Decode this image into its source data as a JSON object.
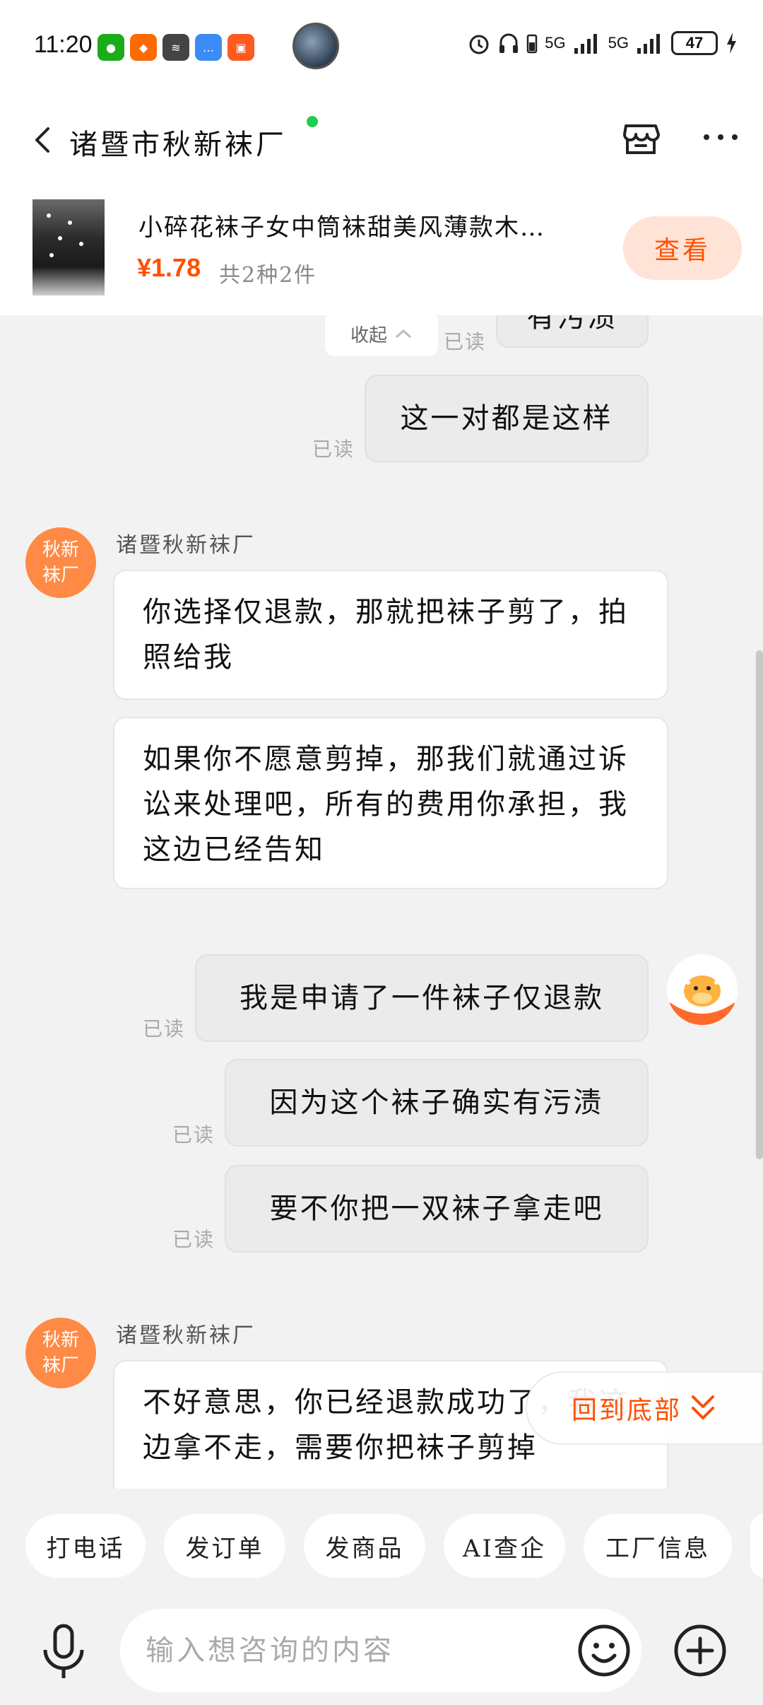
{
  "status": {
    "time": "11:20",
    "app_icons": [
      "wechat-icon",
      "1688-icon",
      "voice-icon",
      "message-icon",
      "app-icon"
    ],
    "network": "5G",
    "battery": "47"
  },
  "header": {
    "shop_name": "诸暨市秋新袜厂",
    "online_color": "#1fce4f"
  },
  "product": {
    "title": "小碎花袜子女中筒袜甜美风薄款木…",
    "price": "¥1.78",
    "qty": "共2种2件",
    "view_label": "查看"
  },
  "chat": {
    "collapse_label": "收起",
    "to_bottom_label": "回到底部",
    "partial_top_text": "有污渍",
    "read_label": "已读",
    "messages": [
      {
        "side": "right",
        "text": "这一对都是这样",
        "read": "已读"
      },
      {
        "side": "left",
        "sender": "诸暨秋新袜厂",
        "avatar": "秋新袜厂",
        "texts": [
          "你选择仅退款，那就把袜子剪了，拍照给我",
          "如果你不愿意剪掉，那我们就通过诉讼来处理吧，所有的费用你承担，我这边已经告知"
        ]
      },
      {
        "side": "right",
        "text": "我是申请了一件袜子仅退款",
        "read": "已读"
      },
      {
        "side": "right",
        "text": "因为这个袜子确实有污渍",
        "read": "已读"
      },
      {
        "side": "right",
        "text": "要不你把一双袜子拿走吧",
        "read": "已读"
      },
      {
        "side": "left",
        "sender": "诸暨秋新袜厂",
        "avatar": "秋新袜厂",
        "texts": [
          "不好意思，你已经退款成功了，我这边拿不走，需要你把袜子剪掉"
        ]
      }
    ]
  },
  "quick_actions": [
    "打电话",
    "发订单",
    "发商品",
    "AI查企",
    "工厂信息"
  ],
  "input": {
    "placeholder": "输入想咨询的内容"
  },
  "colors": {
    "accent": "#ff5000",
    "avatar_orange": "#ff8a45",
    "background": "#f2f2f2"
  }
}
